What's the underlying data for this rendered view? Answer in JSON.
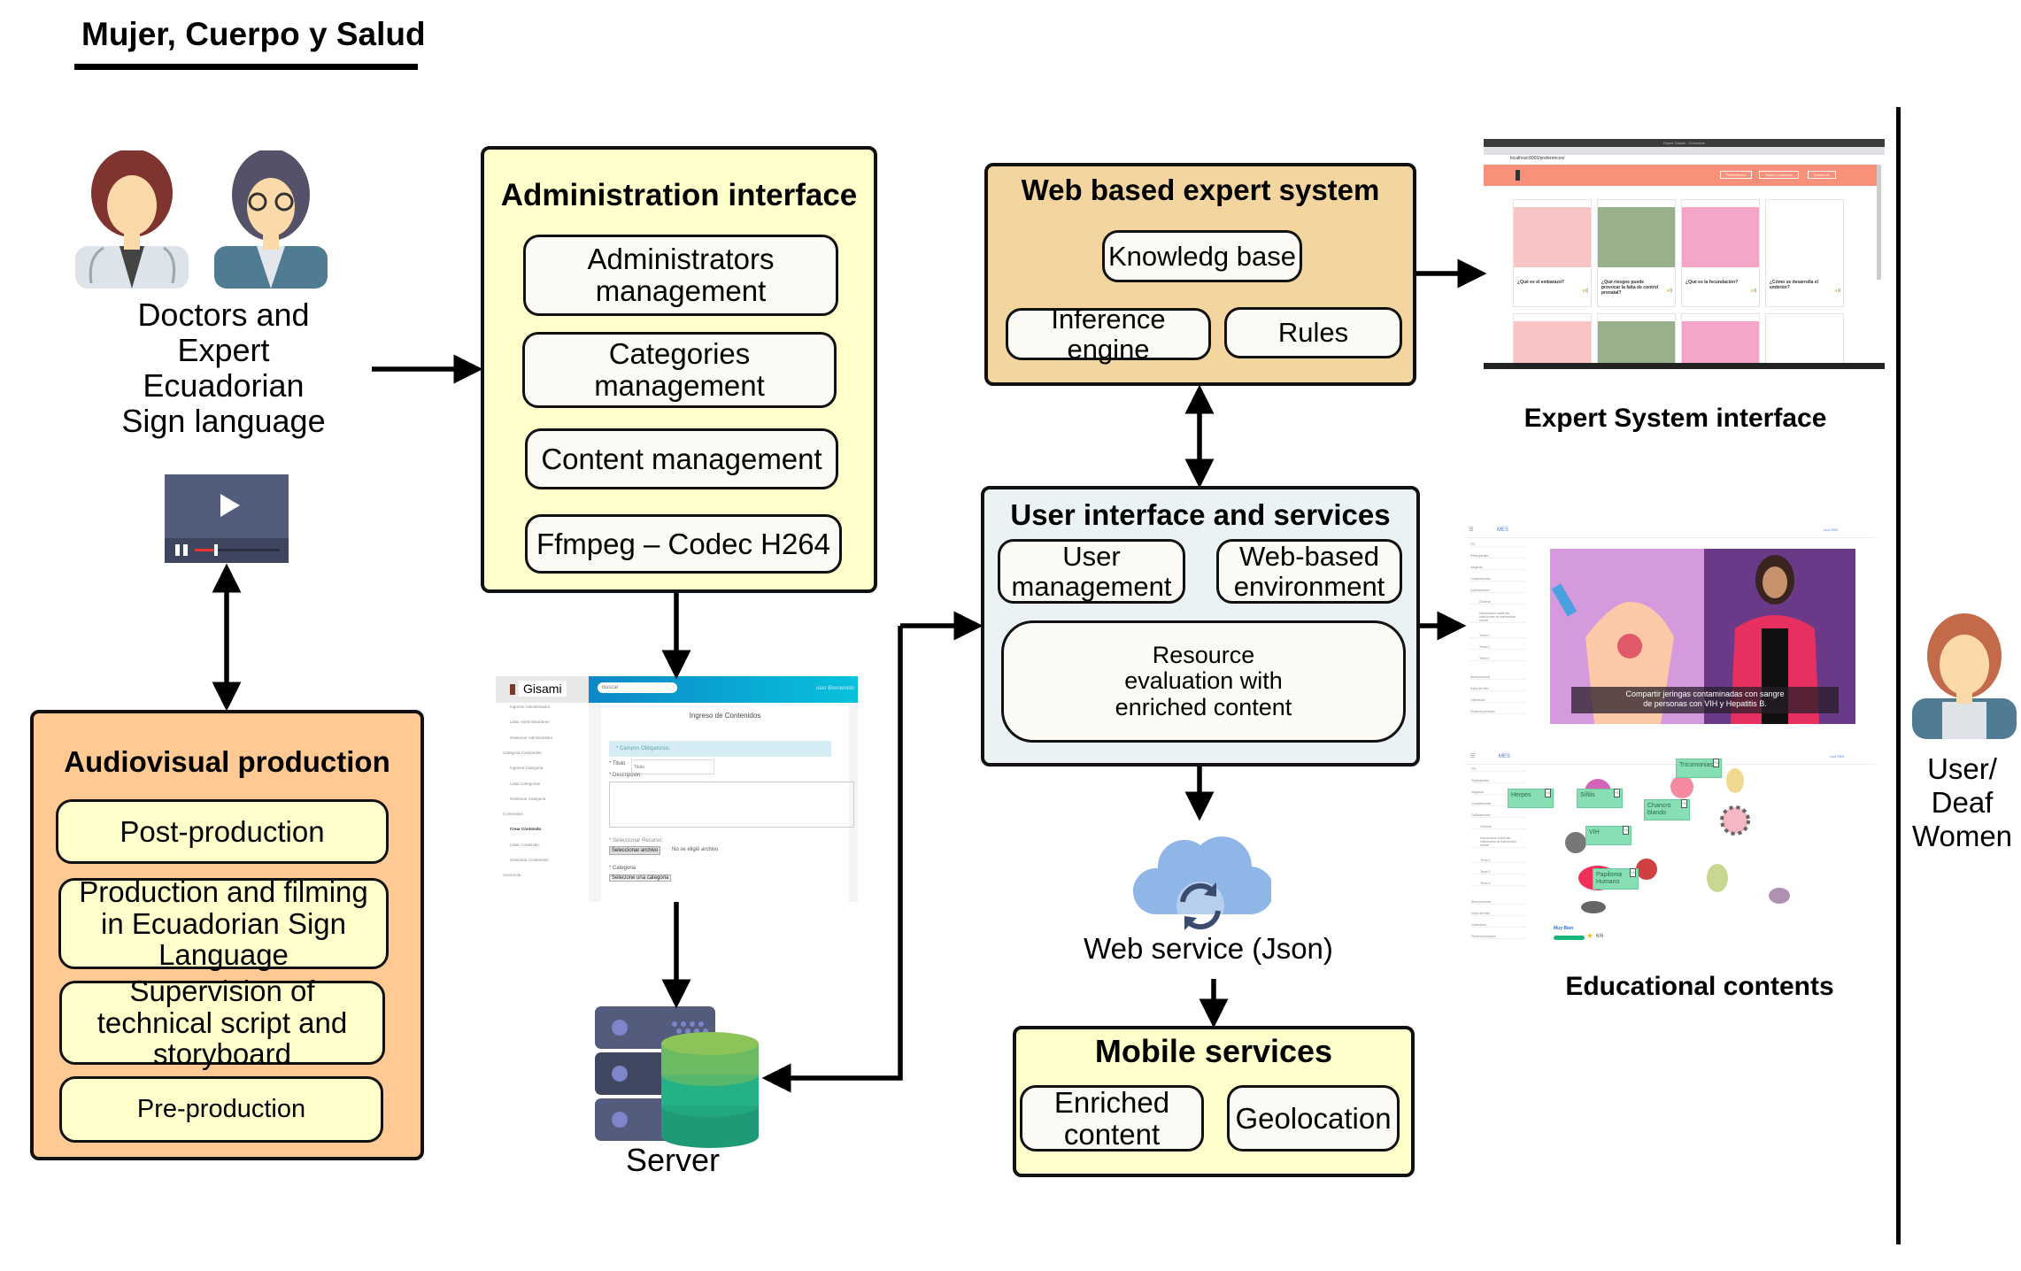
{
  "header": {
    "title": "Mujer, Cuerpo y Salud"
  },
  "actors": {
    "experts_label": [
      "Doctors and",
      "Expert",
      "Ecuadorian",
      "Sign language"
    ],
    "user_label": [
      "User/",
      "Deaf",
      "Women"
    ]
  },
  "audiovisual": {
    "title": "Audiovisual production",
    "items": [
      "Post-production",
      "Production and filming in Ecuadorian Sign Language",
      "Supervision of technical script and storyboard",
      "Pre-production"
    ]
  },
  "admin": {
    "title": "Administration interface",
    "items": [
      "Administrators management",
      "Categories management",
      "Content management",
      "Ffmpeg – Codec H264"
    ]
  },
  "admin_screenshot": {
    "logo": "Gisami",
    "search_placeholder": "Buscar",
    "user": "user Bienvenido",
    "sidebar": [
      "Ingresar Administrador",
      "Listar Administradores",
      "Gestionar Administrador",
      "Categoria Contenidos",
      "Ingresar Categoria",
      "Listar Categorias",
      "Gestionar Categoria",
      "Contenidos",
      "Crear Contenido",
      "Listar Contenido",
      "Gestionar Contenidos",
      "Acerca de.."
    ],
    "form_title": "Ingreso de Contenidos",
    "notice": "* Campos Obligatorios.",
    "titulo_label": "* Titulo",
    "titulo_placeholder": "Titulo",
    "descripcion_label": "* Descripción:",
    "recurso_label": "* Seleccionar Recurso:",
    "file_button": "Seleccionar archivo",
    "file_status": "No se eligió archivo",
    "categoria_label": "* Categoria",
    "categoria_select": "Selecione una categoria"
  },
  "server": {
    "label": "Server"
  },
  "expert": {
    "title": "Web based expert system",
    "items": [
      "Knowledg base",
      "Inference engine",
      "Rules"
    ]
  },
  "expert_screenshot": {
    "caption": "Expert System interface",
    "window_title": "Expert Gisami - Chromium",
    "url": "localhost:8000/preferences/",
    "nav": [
      "Preferencias",
      "Nuevo Contenido",
      "Acerca de"
    ],
    "cards": [
      "¿Qué es el embarazo?",
      "¿Qué riesgos puede provocar la falta de control prenatal?",
      "¿Qué es la fecundación?",
      "¿Cómo se desarrolla el embrión?"
    ],
    "card_rating": "0"
  },
  "ui": {
    "title": "User interface and services",
    "items": [
      "User management",
      "Web-based environment",
      "Resource evaluation with enriched content"
    ]
  },
  "edu_screenshot": {
    "caption": "Educational contents",
    "brand": "MES",
    "user": "root SSR",
    "sidebar": [
      "ITS",
      "Participantes",
      "Insignias",
      "Competencias",
      "Calificaciones",
      "General",
      "Introducción sobre las infecciones de transmisión sexual",
      "Tema 2",
      "Tema 3",
      "Tema 4",
      "Área personal",
      "Inicio del sitio",
      "Calendario",
      "Ficheros privados"
    ],
    "subtitle": "Compartir jeringas contaminadas con sangre de personas con VIH y Hepatitis B.",
    "tags": [
      "Tricomoniasis",
      "Herpes",
      "Sífilis",
      "Chancro blando",
      "VIH",
      "Papiloma Humano"
    ],
    "tag_badge": "+1",
    "feedback": "Muy Bien",
    "score": "6/6",
    "score_fraction": 1.0
  },
  "webservice": {
    "label": "Web service (Json)"
  },
  "mobile": {
    "title": "Mobile services",
    "items": [
      "Enriched content",
      "Geolocation"
    ]
  },
  "colors": {
    "audiovisual_fill": "#FFC994",
    "admin_fill": "#FFFFCC",
    "expert_fill": "#F3D59F",
    "ui_fill": "#EAF2F4",
    "mobile_fill": "#FFFFCC",
    "subbox_fill": "#FBFAF5"
  }
}
